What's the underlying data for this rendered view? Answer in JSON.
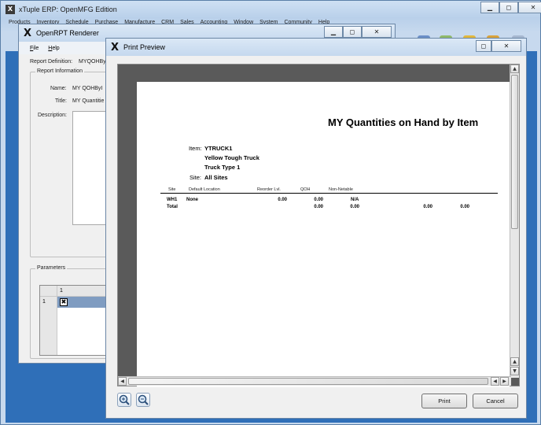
{
  "main_window": {
    "title": "xTuple ERP: OpenMFG Edition",
    "menu": [
      "Products",
      "Inventory",
      "Schedule",
      "Purchase",
      "Manufacture",
      "CRM",
      "Sales",
      "Accounting",
      "Window",
      "System",
      "Community",
      "Help"
    ]
  },
  "renderer": {
    "title": "OpenRPT Renderer",
    "menu": [
      {
        "label": "File",
        "accel": "F"
      },
      {
        "label": "Help",
        "accel": "H"
      }
    ],
    "report_definition_label": "Report Definition:",
    "report_definition_value": "MYQOHByI",
    "report_info_title": "Report Information",
    "name_label": "Name:",
    "name_value": "MY QOHByI",
    "title_label": "Title:",
    "title_value": "MY Quantitie",
    "description_label": "Description:",
    "parameters_title": "Parameters",
    "param_table": {
      "column_header": "1",
      "rows": [
        {
          "num": "1",
          "checked": true
        }
      ]
    }
  },
  "preview": {
    "title": "Print Preview",
    "report": {
      "title": "MY Quantities on Hand by Item",
      "item_label": "Item:",
      "item_code": "YTRUCK1",
      "item_desc1": "Yellow Tough Truck",
      "item_desc2": "Truck Type 1",
      "site_label": "Site:",
      "site_value": "All Sites",
      "columns": [
        "Site",
        "Default Location",
        "Reorder Lvl.",
        "QOH",
        "Non-Netable"
      ],
      "rows": [
        {
          "site": "WH1",
          "location": "None",
          "reorder": "0.00",
          "qoh": "0.00",
          "nonnet": "N/A",
          "c6": "",
          "c7": ""
        },
        {
          "site": "Total",
          "location": "",
          "reorder": "",
          "qoh": "0.00",
          "nonnet": "0.00",
          "c6": "0.00",
          "c7": "0.00"
        }
      ]
    },
    "print_label": "Print",
    "cancel_label": "Cancel"
  },
  "icons": {
    "main_window_logo": "xtuple-logo-icon",
    "minimize": "minimize-icon",
    "maximize": "maximize-icon",
    "close": "close-icon",
    "zoom_in": "zoom-in-icon",
    "zoom_out": "zoom-out-icon"
  }
}
